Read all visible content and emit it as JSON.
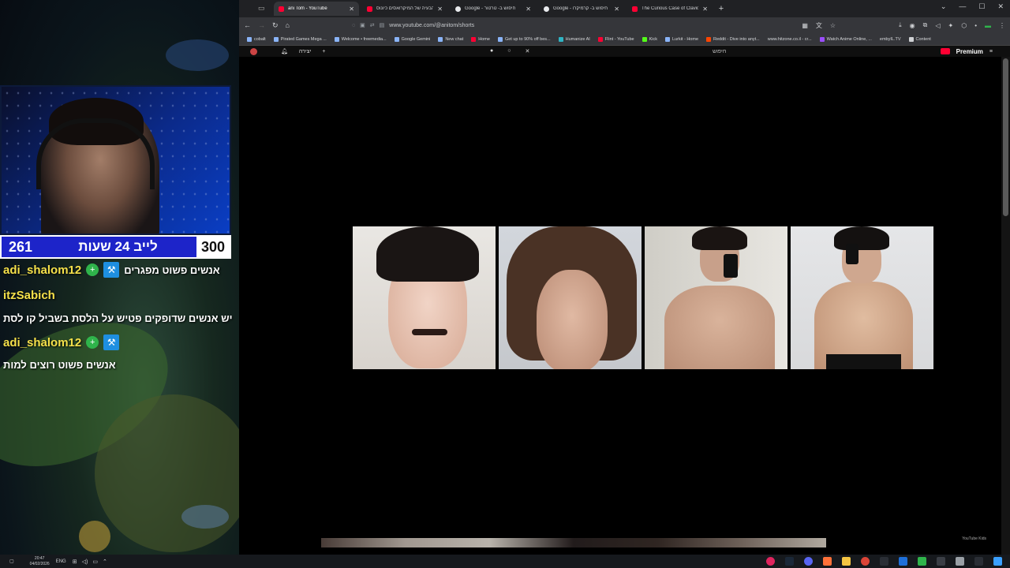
{
  "overlay": {
    "counter": {
      "left_number": "261",
      "label": "לייב 24 שעות",
      "right_number": "300"
    },
    "chat": [
      {
        "user": "adi_shalom12",
        "message": "אנשים פשוט מפגרים",
        "badges": true
      },
      {
        "user": "itzSabich",
        "message": "יש אנשים שדופקים פטיש על הלסת בשביל קו לסת",
        "badges": false
      },
      {
        "user": "adi_shalom12",
        "message": "אנשים פשוט רוצים למות",
        "badges": true
      }
    ],
    "badge_icons": {
      "green": "+",
      "mod": "⚒"
    }
  },
  "browser": {
    "tabs": [
      {
        "label": "ani Tom - YouTube",
        "active": true,
        "favicon": "youtube-icon"
      },
      {
        "label": "הבעיה של המיקרואסים כיונוס",
        "active": false,
        "favicon": "youtube-icon"
      },
      {
        "label": "Google - חיפוש ב- טרטור",
        "active": false,
        "favicon": "google-icon"
      },
      {
        "label": "Google - חיפוש ב- קרמיקרו",
        "active": false,
        "favicon": "google-icon"
      },
      {
        "label": "The Curious Case of Clavicular",
        "active": false,
        "favicon": "youtube-icon"
      }
    ],
    "new_tab": "+",
    "window_controls": [
      "⌄",
      "—",
      "☐",
      "✕"
    ],
    "nav_icons": [
      "←",
      "→",
      "↻",
      "⌂"
    ],
    "url": "www.youtube.com/@anitom/shorts",
    "bookmarks": [
      "cobalt",
      "Pirated Games Mega ...",
      "Welcome • freemedia...",
      "Google Gemini",
      "New chat",
      "Home",
      "Get up to 90% off bes...",
      "Humanize AI",
      "Flint - YouTube",
      "Kick",
      "Lurkit - Home",
      "Reddit - Dive into anyt...",
      "www.hitzone.co.il - cr...",
      "Watch Anime Online, ...",
      "embyIL.TV",
      "Content"
    ],
    "youtube": {
      "search_placeholder": "חיפוש",
      "create_label": "יצירה",
      "premium_label": "Premium",
      "corner_text": "YouTube Kids"
    }
  },
  "taskbar": {
    "time": "20:47",
    "date": "04/02/2026",
    "language": "ENG"
  },
  "colors": {
    "youtube_red": "#ff0033",
    "counter_blue": "#1d24c9",
    "chat_user": "#f5e04a"
  }
}
